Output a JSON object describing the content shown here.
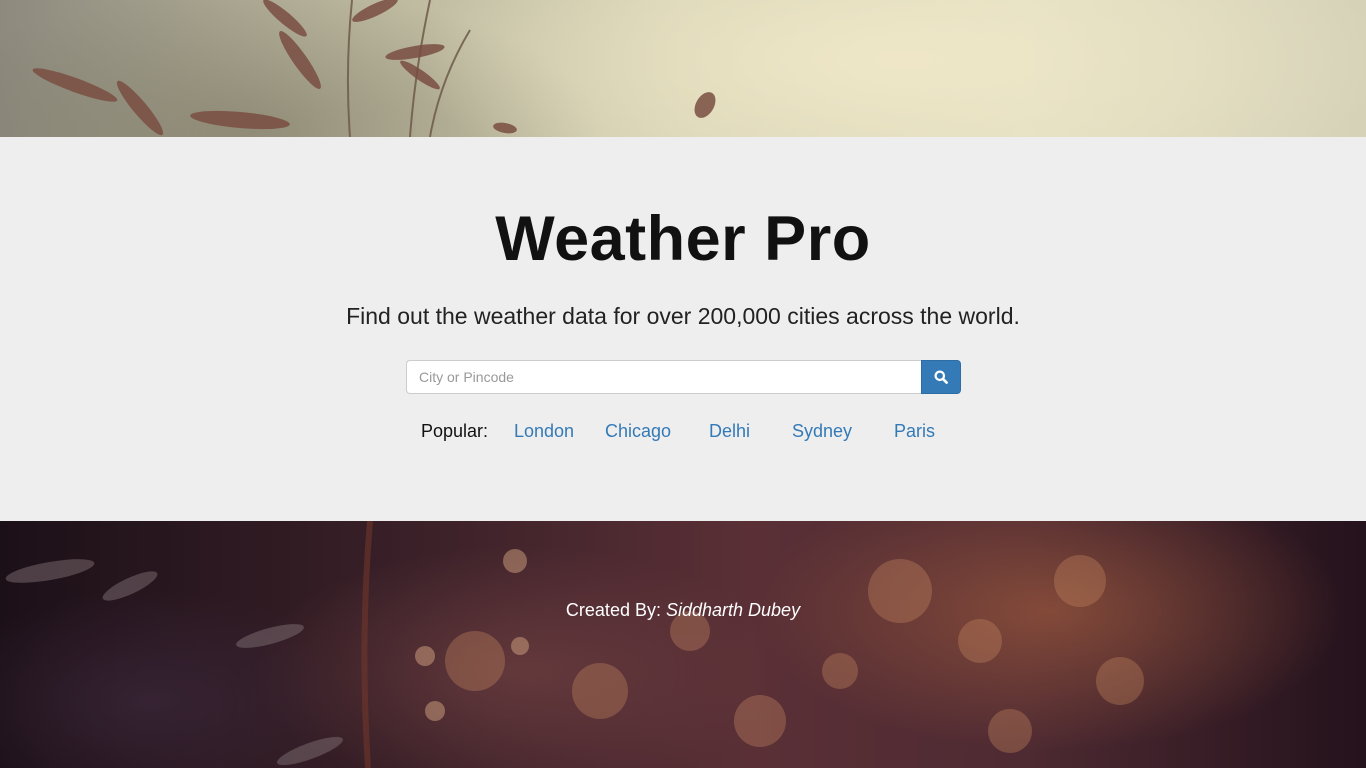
{
  "header": {
    "title": "Weather Pro",
    "subtitle": "Find out the weather data for over 200,000 cities across the world."
  },
  "search": {
    "placeholder": "City or Pincode",
    "value": "",
    "button_icon": "search-icon"
  },
  "popular": {
    "label": "Popular:",
    "cities": [
      "London",
      "Chicago",
      "Delhi",
      "Sydney",
      "Paris"
    ]
  },
  "footer": {
    "credit_prefix": "Created By:",
    "author": "Siddharth Dubey"
  },
  "colors": {
    "accent": "#337ab7",
    "jumbotron_bg": "#eeeeee",
    "title": "#111111",
    "footer_text": "#ffffff"
  }
}
